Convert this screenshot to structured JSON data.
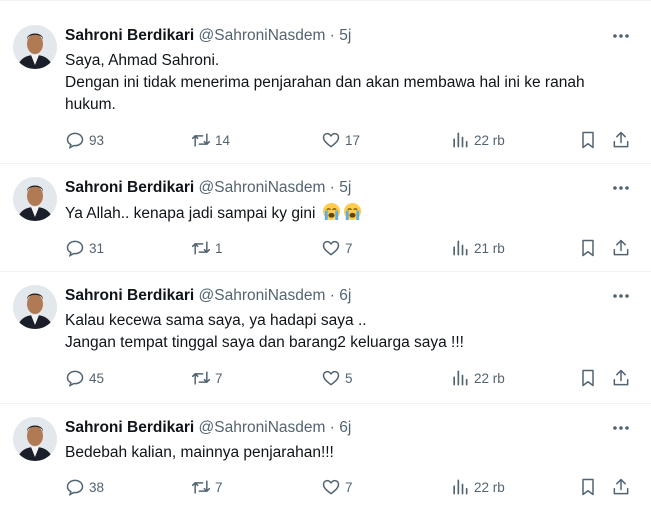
{
  "tweets": [
    {
      "author_name": "Sahroni Berdikari",
      "handle": "@SahroniNasdem",
      "separator": "·",
      "time": "5j",
      "text_lines": [
        "Saya, Ahmad Sahroni.",
        "Dengan ini tidak menerima penjarahan dan akan membawa hal ini ke ranah",
        "hukum."
      ],
      "replies": "93",
      "retweets": "14",
      "likes": "17",
      "views": "22 rb"
    },
    {
      "author_name": "Sahroni Berdikari",
      "handle": "@SahroniNasdem",
      "separator": "·",
      "time": "5j",
      "text_lines": [
        "Ya Allah.. kenapa jadi sampai ky gini"
      ],
      "emoji": [
        "loudly-crying-face",
        "loudly-crying-face"
      ],
      "replies": "31",
      "retweets": "1",
      "likes": "7",
      "views": "21 rb"
    },
    {
      "author_name": "Sahroni Berdikari",
      "handle": "@SahroniNasdem",
      "separator": "·",
      "time": "6j",
      "text_lines": [
        "Kalau kecewa sama saya, ya hadapi saya ..",
        "Jangan tempat tinggal saya dan barang2 keluarga saya !!!"
      ],
      "replies": "45",
      "retweets": "7",
      "likes": "5",
      "views": "22 rb"
    },
    {
      "author_name": "Sahroni Berdikari",
      "handle": "@SahroniNasdem",
      "separator": "·",
      "time": "6j",
      "text_lines": [
        "Bedebah kalian, mainnya penjarahan!!!"
      ],
      "replies": "38",
      "retweets": "7",
      "likes": "7",
      "views": "22 rb"
    }
  ],
  "icons": {
    "more": "more-horizontal-icon",
    "reply": "reply-icon",
    "retweet": "retweet-icon",
    "like": "heart-icon",
    "views": "views-bar-chart-icon",
    "bookmark": "bookmark-icon",
    "share": "share-icon"
  },
  "colors": {
    "text": "#0f1419",
    "secondary": "#536471",
    "divider": "#eff3f4"
  }
}
